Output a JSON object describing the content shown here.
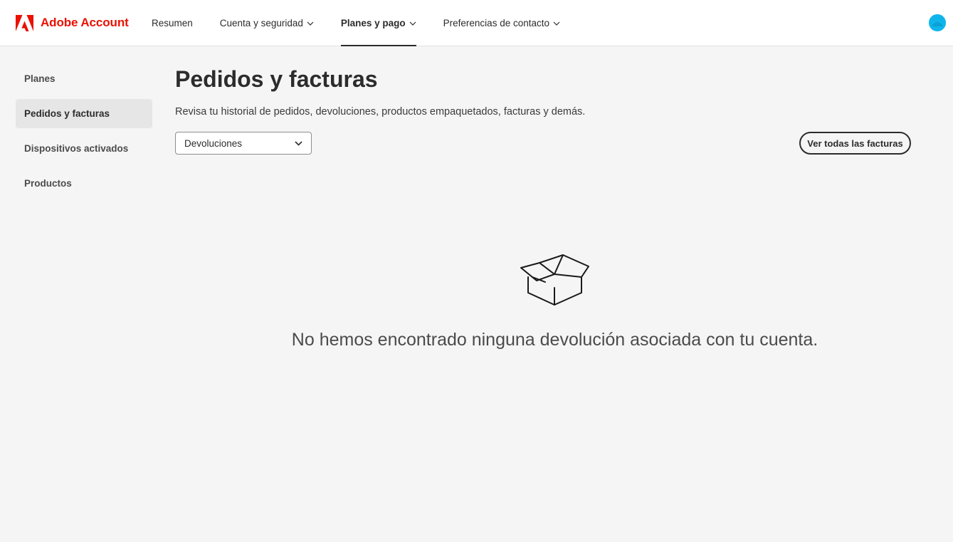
{
  "header": {
    "brand_name": "Adobe Account",
    "brand_color": "#eb1000",
    "nav": [
      {
        "label": "Resumen",
        "has_dropdown": false,
        "active": false
      },
      {
        "label": "Cuenta y seguridad",
        "has_dropdown": true,
        "active": false
      },
      {
        "label": "Planes y pago",
        "has_dropdown": true,
        "active": true
      },
      {
        "label": "Preferencias de contacto",
        "has_dropdown": true,
        "active": false
      }
    ],
    "avatar_color": "#0fb5ea"
  },
  "sidebar": {
    "items": [
      {
        "label": "Planes",
        "active": false
      },
      {
        "label": "Pedidos y facturas",
        "active": true
      },
      {
        "label": "Dispositivos activados",
        "active": false
      },
      {
        "label": "Productos",
        "active": false
      }
    ]
  },
  "main": {
    "title": "Pedidos y facturas",
    "subtitle": "Revisa tu historial de pedidos, devoluciones, productos empaquetados, facturas y demás.",
    "filter_select": {
      "value": "Devoluciones"
    },
    "view_all_button": "Ver todas las facturas",
    "empty_state": {
      "icon": "open-box-icon",
      "message": "No hemos encontrado ninguna devolución asociada con tu cuenta."
    }
  }
}
